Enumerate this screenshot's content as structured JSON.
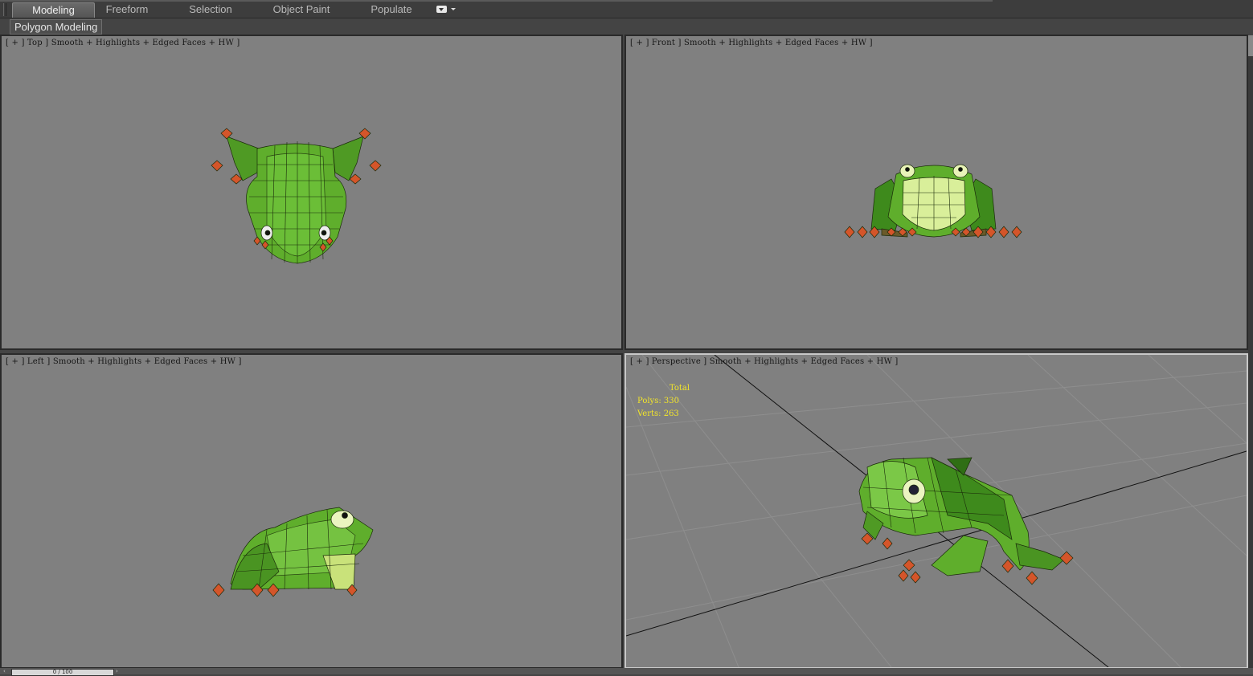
{
  "ribbon": {
    "tabs": [
      {
        "label": "Modeling",
        "active": true
      },
      {
        "label": "Freeform",
        "active": false
      },
      {
        "label": "Selection",
        "active": false
      },
      {
        "label": "Object Paint",
        "active": false
      },
      {
        "label": "Populate",
        "active": false
      }
    ],
    "options_icon": "dropdown-options-icon"
  },
  "subpanel": {
    "label": "Polygon Modeling"
  },
  "viewports": {
    "top": {
      "label": "[ + ] Top ] Smooth + Highlights + Edged Faces + HW ]"
    },
    "front": {
      "label": "[ + ] Front ] Smooth + Highlights + Edged Faces + HW ]"
    },
    "left": {
      "label": "[ + ] Left ] Smooth + Highlights + Edged Faces + HW ]"
    },
    "perspective": {
      "label": "[ + ] Perspective ] Smooth + Highlights + Edged Faces + HW ]",
      "active": true,
      "stats": {
        "total_label": "Total",
        "polys": "Polys: 330",
        "verts": "Verts: 263"
      }
    }
  },
  "colors": {
    "viewport_bg": "#808080",
    "frog_green": "#5fae2c",
    "frog_dark": "#2f6e14",
    "frog_belly": "#d9ef9a",
    "toe_orange": "#d4552a",
    "stats_yellow": "#f2e52a"
  },
  "timeline": {
    "frame": "0 / 100"
  }
}
